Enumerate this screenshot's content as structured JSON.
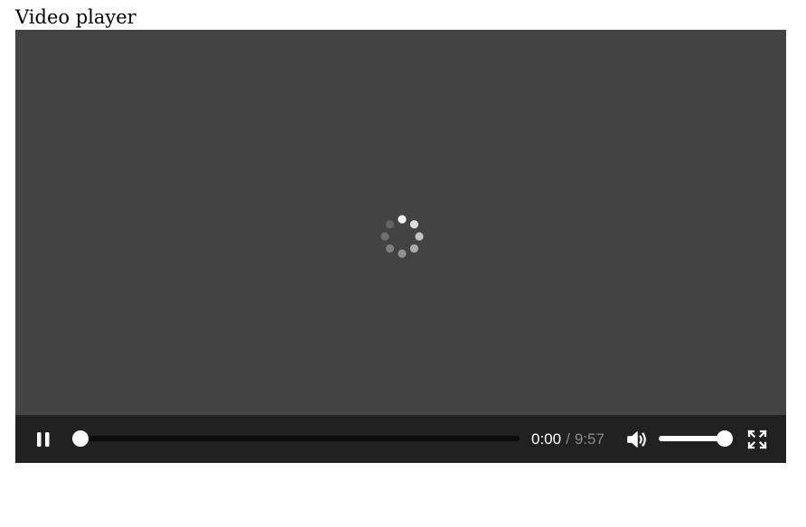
{
  "page": {
    "title": "Video player"
  },
  "player": {
    "state": "loading",
    "playback": "playing",
    "background_color": "#434343",
    "controls_background": "#212121",
    "icons": {
      "play_pause": "pause-icon",
      "volume": "volume-icon",
      "fullscreen": "fullscreen-icon",
      "loading": "loading-spinner-icon"
    },
    "progress": {
      "fraction": 0
    },
    "time": {
      "current": "0:00",
      "separator": "/",
      "duration": "9:57"
    },
    "volume": {
      "fraction": 1
    }
  }
}
